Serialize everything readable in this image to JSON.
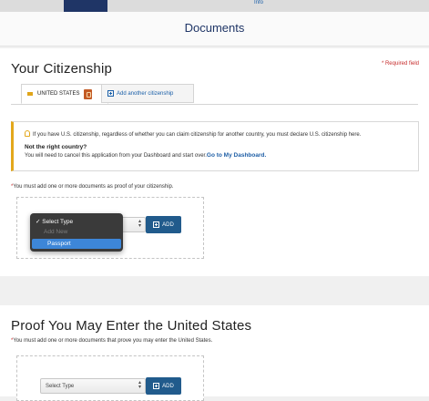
{
  "topbar": {
    "info_label": "Info"
  },
  "header": {
    "title": "Documents"
  },
  "citizenship": {
    "heading": "Your Citizenship",
    "required_note": "* Required field",
    "tabs": [
      {
        "label": "UNITED STATES"
      },
      {
        "label": "Add another citizenship"
      }
    ],
    "alert": {
      "line1": "If you have U.S. citizenship, regardless of whether you can claim citizenship for another country, you must declare U.S. citizenship here.",
      "line2": "Not the right country?",
      "line3": "You will need to cancel this application from your Dashboard and start over.",
      "link": "Go to My Dashboard."
    },
    "must_add_star": "*",
    "must_add": "You must add one or more documents as proof of your citizenship.",
    "add_button": "ADD",
    "dropdown_options": [
      {
        "label": "Select Type",
        "checked": true
      },
      {
        "label": "Add New",
        "disabled": true
      },
      {
        "label": "Passport",
        "highlighted": true
      }
    ]
  },
  "entry": {
    "heading": "Proof You May Enter the United States",
    "must_add_star": "*",
    "must_add": "You must add one or more documents that prove you may enter the United States.",
    "select_value": "Select Type",
    "add_button": "ADD"
  },
  "icons": [
    "us-flag-icon",
    "passport-icon",
    "plus-box-icon",
    "lightbulb-icon",
    "checkmark-icon",
    "select-arrows-icon"
  ],
  "colors": {
    "navy": "#1f3566",
    "button": "#215b8c",
    "link": "#1a5fa8",
    "required": "#c62b2b",
    "alert_border": "#e3a81c",
    "highlight": "#3d86d8"
  }
}
